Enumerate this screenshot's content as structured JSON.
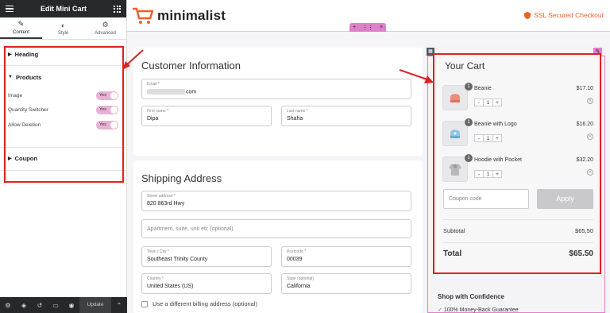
{
  "panel": {
    "title": "Edit Mini Cart",
    "tabs": [
      {
        "label": "Content",
        "icon": "pencil-icon"
      },
      {
        "label": "Style",
        "icon": "contrast-icon"
      },
      {
        "label": "Advanced",
        "icon": "gear-icon"
      }
    ],
    "sections": {
      "heading": "Heading",
      "products": "Products",
      "coupon": "Coupon"
    },
    "controls": [
      {
        "label": "Image",
        "value": "Yes"
      },
      {
        "label": "Quantity Switcher",
        "value": "Yes"
      },
      {
        "label": "Allow Deletion",
        "value": "Yes"
      }
    ],
    "footer": {
      "update": "Update"
    }
  },
  "site": {
    "brand": "minimalist",
    "ssl": "SSL Secured Checkout",
    "accent": "#e8632a"
  },
  "customer": {
    "title": "Customer Information",
    "email_label": "Email *",
    "email_value": "com",
    "first_label": "First name *",
    "first_value": "Dipa",
    "last_label": "Last name *",
    "last_value": "Shaha"
  },
  "shipping": {
    "title": "Shipping Address",
    "street_label": "Street address *",
    "street_value": "820 863rd Hwy",
    "apt_placeholder": "Apartment, suite, unit etc (optional)",
    "town_label": "Town / City *",
    "town_value": "Southeast Trinity County",
    "postcode_label": "Postcode *",
    "postcode_value": "00039",
    "country_label": "Country *",
    "country_value": "United States (US)",
    "state_label": "State (optional)",
    "state_value": "California",
    "billing_label": "Use a different billing address (optional)"
  },
  "cart": {
    "title": "Your Cart",
    "items": [
      {
        "name": "Beanie",
        "price": "$17.10",
        "qty": "1",
        "badge": "1"
      },
      {
        "name": "Beanie with Logo",
        "price": "$16.20",
        "qty": "1",
        "badge": "1"
      },
      {
        "name": "Hoodie with Pocket",
        "price": "$32.20",
        "qty": "1",
        "badge": "1"
      }
    ],
    "coupon_placeholder": "Coupon code",
    "apply": "Apply",
    "subtotal_label": "Subtotal",
    "subtotal_value": "$65.50",
    "total_label": "Total",
    "total_value": "$65.50"
  },
  "confidence": {
    "title": "Shop with Confidence",
    "item": "100% Money-Back Guarantee"
  }
}
